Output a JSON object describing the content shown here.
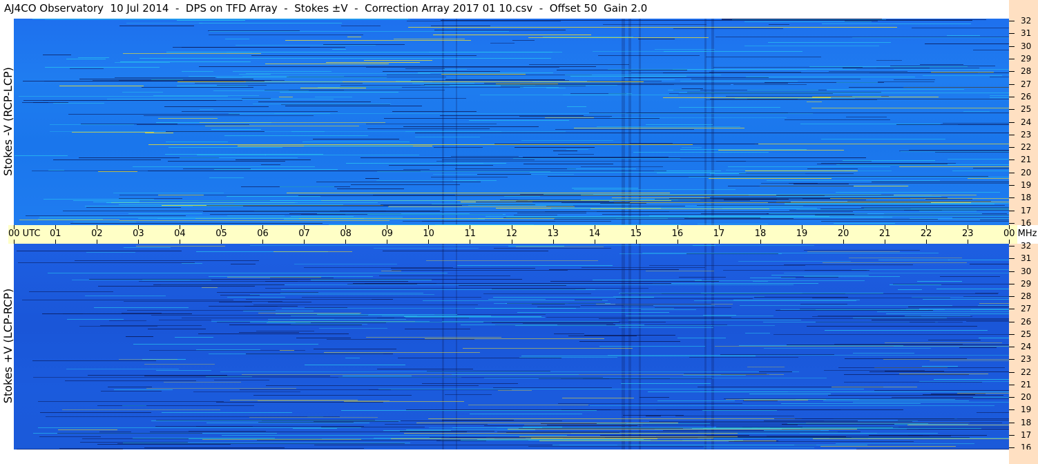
{
  "title": "AJ4CO Observatory  10 Jul 2014  -  DPS on TFD Array  -  Stokes ±V  -  Correction Array 2017 01 10.csv  -  Offset 50  Gain 2.0",
  "panels": {
    "top": {
      "ylabel": "Stokes -V (RCP-LCP)"
    },
    "bottom": {
      "ylabel": "Stokes +V (LCP-RCP)"
    }
  },
  "time_axis": {
    "labels": [
      "00 UTC",
      "01",
      "02",
      "03",
      "04",
      "05",
      "06",
      "07",
      "08",
      "09",
      "10",
      "11",
      "12",
      "13",
      "14",
      "15",
      "16",
      "17",
      "18",
      "19",
      "20",
      "21",
      "22",
      "23",
      "00 MHz"
    ]
  },
  "freq_axis": {
    "labels": [
      "32",
      "31",
      "30",
      "29",
      "28",
      "27",
      "26",
      "25",
      "24",
      "23",
      "22",
      "21",
      "20",
      "19",
      "18",
      "17",
      "16"
    ]
  },
  "colors": {
    "background_top": "#1f7cf0",
    "background_bottom": "#1b5bdd",
    "time_axis_bg": "#ffffc6",
    "freq_axis_bg": "#ffe0c2",
    "line_dark": "#0a1a5a",
    "line_bright": "#29c8f0",
    "line_hot": "#f0e030"
  },
  "chart_data": {
    "type": "heatmap",
    "title": "AJ4CO Observatory  10 Jul 2014  -  DPS on TFD Array  -  Stokes ±V  -  Correction Array 2017 01 10.csv  -  Offset 50  Gain 2.0",
    "x_unit": "UTC hour",
    "y_unit": "MHz",
    "x_range": [
      0,
      24
    ],
    "y_range": [
      16,
      32
    ],
    "panels": [
      "Stokes -V (RCP-LCP)",
      "Stokes +V (LCP-RCP)"
    ],
    "grid": false
  }
}
